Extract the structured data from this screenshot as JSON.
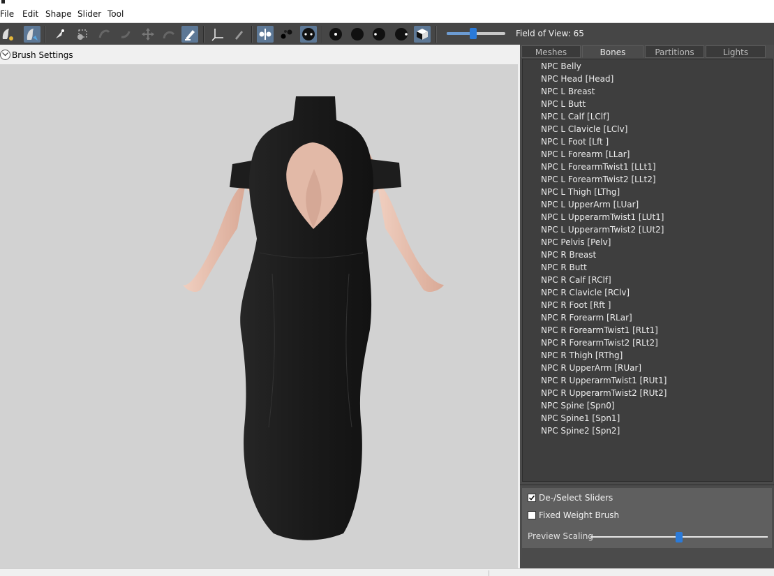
{
  "menu": [
    "File",
    "Edit",
    "Shape",
    "Slider",
    "Tool"
  ],
  "toolbar": {
    "fov_label": "Field of View: 65",
    "fov_value": 0.45,
    "icons": [
      "mask-brush-icon",
      "inflate-brush-icon",
      "select-icon",
      "marquee-icon",
      "move-brush-icon",
      "smooth-brush-icon",
      "transform-icon",
      "undo-icon",
      "weight-brush-icon",
      "axes-icon",
      "eraser-icon",
      "symmetry-icon",
      "vertex-icon",
      "edge-icon",
      "point-icon",
      "sphere-icon",
      "half-sphere-icon",
      "shadow-sphere-icon",
      "cube-icon"
    ]
  },
  "brush_settings": {
    "label": "Brush Settings"
  },
  "tabs": [
    {
      "label": "Meshes",
      "active": false
    },
    {
      "label": "Bones",
      "active": true
    },
    {
      "label": "Partitions",
      "active": false
    },
    {
      "label": "Lights",
      "active": false
    }
  ],
  "bones": [
    "NPC Belly",
    "NPC Head [Head]",
    "NPC L Breast",
    "NPC L Butt",
    "NPC L Calf [LClf]",
    "NPC L Clavicle [LClv]",
    "NPC L Foot [Lft ]",
    "NPC L Forearm [LLar]",
    "NPC L ForearmTwist1 [LLt1]",
    "NPC L ForearmTwist2 [LLt2]",
    "NPC L Thigh [LThg]",
    "NPC L UpperArm [LUar]",
    "NPC L UpperarmTwist1 [LUt1]",
    "NPC L UpperarmTwist2 [LUt2]",
    "NPC Pelvis [Pelv]",
    "NPC R Breast",
    "NPC R Butt",
    "NPC R Calf [RClf]",
    "NPC R Clavicle [RClv]",
    "NPC R Foot [Rft ]",
    "NPC R Forearm [RLar]",
    "NPC R ForearmTwist1 [RLt1]",
    "NPC R ForearmTwist2 [RLt2]",
    "NPC R Thigh [RThg]",
    "NPC R UpperArm [RUar]",
    "NPC R UpperarmTwist1 [RUt1]",
    "NPC R UpperarmTwist2 [RUt2]",
    "NPC Spine [Spn0]",
    "NPC Spine1 [Spn1]",
    "NPC Spine2 [Spn2]"
  ],
  "options": {
    "deselect_sliders": {
      "label": "De-/Select Sliders",
      "checked": true
    },
    "fixed_weight_brush": {
      "label": "Fixed Weight Brush",
      "checked": false
    },
    "preview_scaling": {
      "label": "Preview Scaling",
      "value": 0.5
    }
  },
  "colors": {
    "toolbar_bg": "#464646",
    "panel_bg": "#4b4b4b",
    "viewport_bg": "#d2d2d2",
    "accent": "#2a7ad9",
    "dress": "#1c1c1c",
    "skin": "#e8c4b3"
  }
}
